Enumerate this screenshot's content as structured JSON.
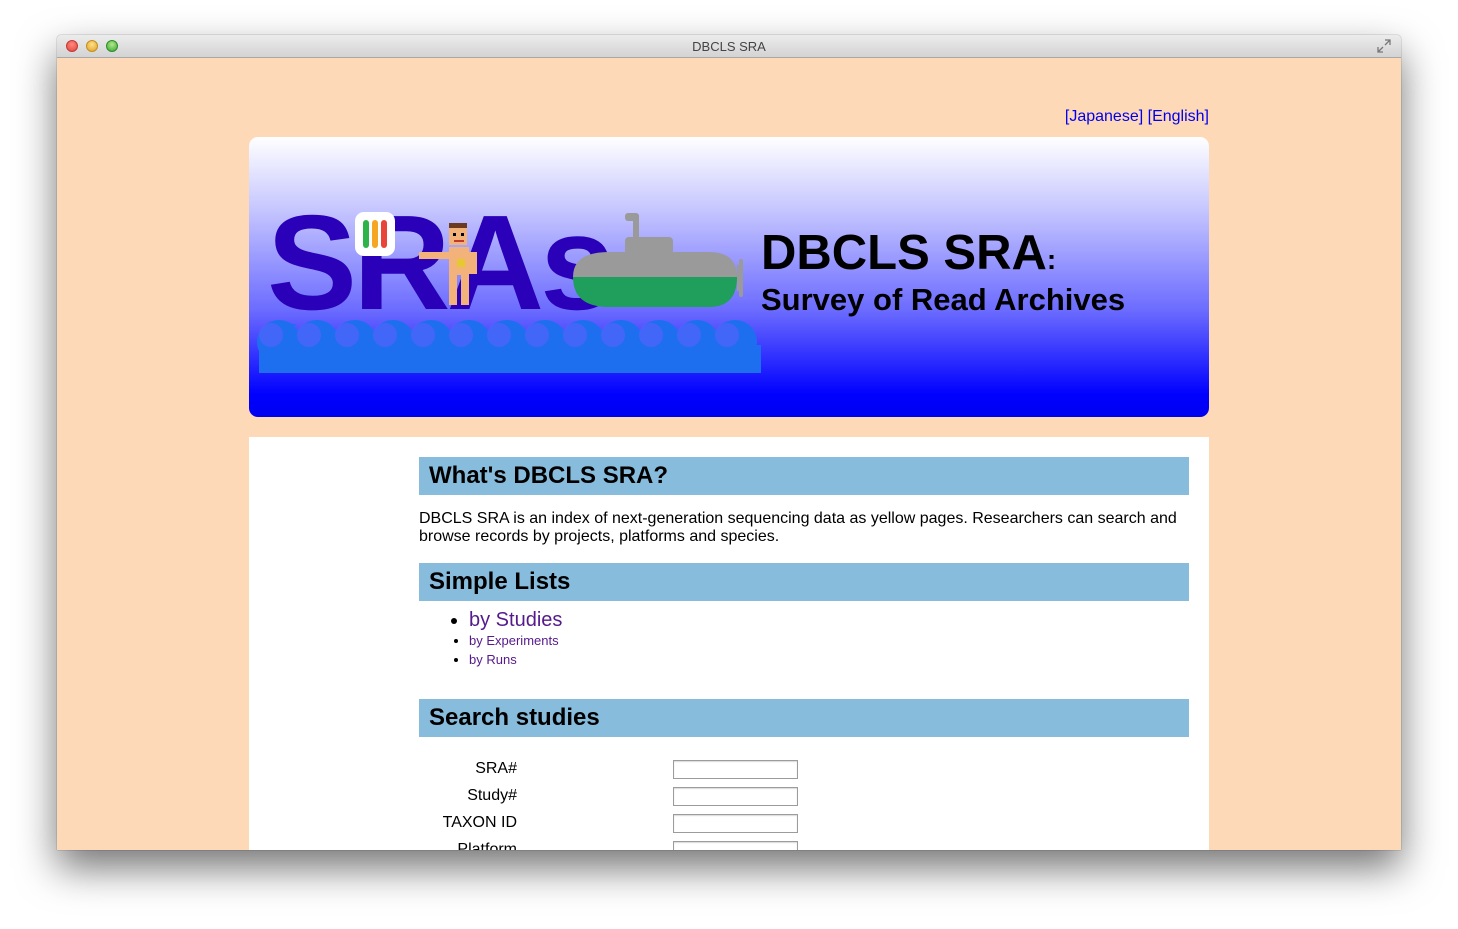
{
  "window": {
    "title": "DBCLS SRA"
  },
  "language_links": {
    "japanese": "[Japanese]",
    "english": "[English]"
  },
  "banner": {
    "logo_text": "SRAs",
    "title": "DBCLS SRA",
    "title_colon": ":",
    "subtitle": "Survey of Read Archives"
  },
  "sections": {
    "whats": {
      "heading": "What's DBCLS SRA?",
      "text": "DBCLS SRA is an index of next-generation sequencing data as yellow pages. Researchers can search and browse records by projects, platforms and species."
    },
    "simple_lists": {
      "heading": "Simple Lists",
      "items": [
        {
          "label": "by Studies"
        },
        {
          "label": "by Experiments"
        },
        {
          "label": "by Runs"
        }
      ]
    },
    "search": {
      "heading": "Search studies",
      "fields": [
        {
          "label": "SRA#",
          "value": ""
        },
        {
          "label": "Study#",
          "value": ""
        },
        {
          "label": "TAXON ID",
          "value": ""
        },
        {
          "label": "Platform",
          "value": ""
        }
      ]
    }
  },
  "colors": {
    "page_background": "#fdd9b7",
    "section_header": "#87bcdd",
    "logo_blue": "#2a00b8",
    "wave_blue": "#1e6ff0",
    "submarine_gray": "#9a9a9a",
    "submarine_green": "#1f9e5c",
    "link": "#0000ee",
    "visited_link": "#551a8b"
  }
}
